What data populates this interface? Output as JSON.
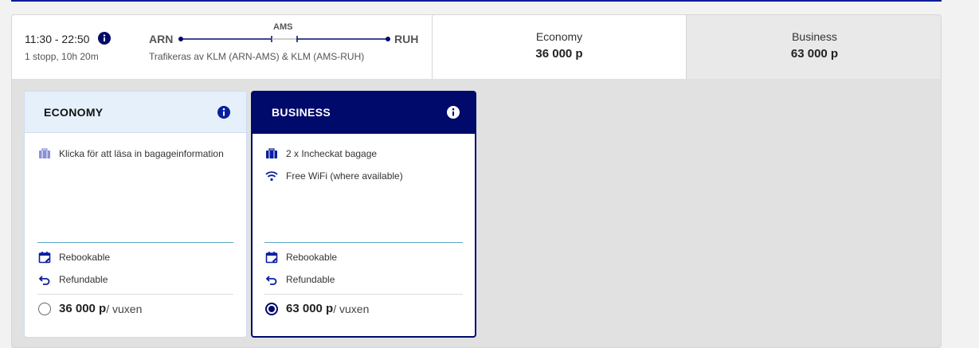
{
  "flight": {
    "time": "11:30 - 22:50",
    "duration": "1 stopp, 10h 20m",
    "origin": "ARN",
    "destination": "RUH",
    "via": "AMS",
    "operated_by": "Trafikeras av KLM (ARN-AMS) & KLM (AMS-RUH)"
  },
  "fares": {
    "economy": {
      "label": "Economy",
      "price": "36 000 p"
    },
    "business": {
      "label": "Business",
      "price": "63 000 p"
    }
  },
  "panels": {
    "economy": {
      "title": "ECONOMY",
      "features": [
        "Klicka för att läsa in bagageinformation"
      ],
      "rebook": "Rebookable",
      "refund": "Refundable",
      "price": "36 000 p",
      "unit": "/ vuxen",
      "selected": false
    },
    "business": {
      "title": "BUSINESS",
      "features": [
        "2 x Incheckat bagage",
        "Free WiFi (where available)"
      ],
      "rebook": "Rebookable",
      "refund": "Refundable",
      "price": "63 000 p",
      "unit": "/ vuxen",
      "selected": true
    }
  },
  "colors": {
    "brand_dark": "#000a6b",
    "brand_blue": "#0a1e9e",
    "economy_header": "#e6f0fb",
    "divider": "#5fa6c7",
    "background": "#e1e1e1"
  }
}
